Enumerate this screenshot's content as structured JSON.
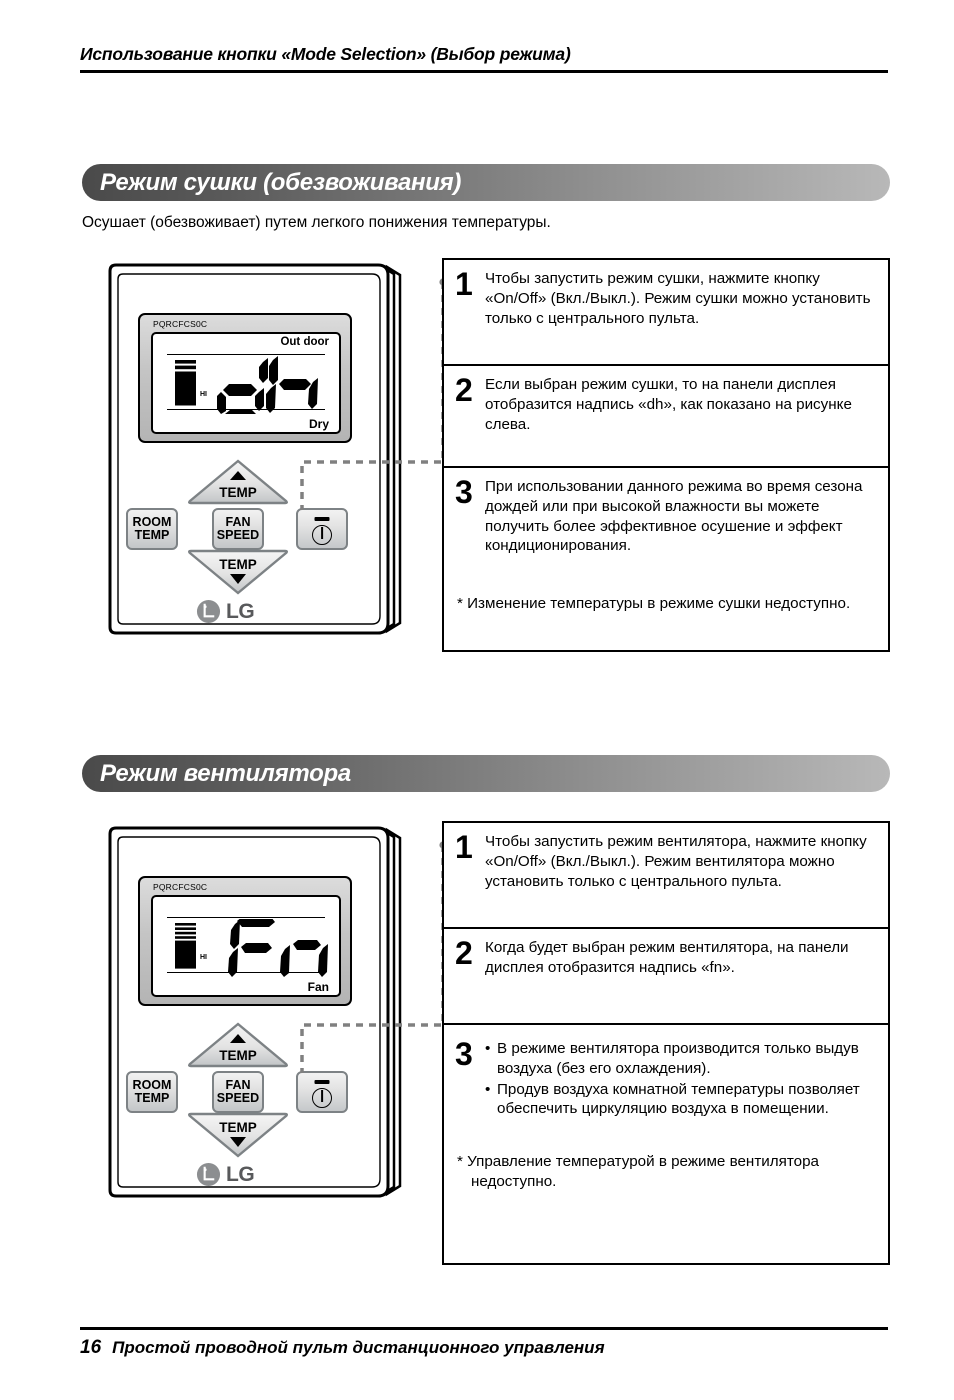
{
  "header": {
    "title": "Использование кнопки «Mode Selection» (Выбор режима)"
  },
  "sections": [
    {
      "id": "dry",
      "bar_title": "Режим сушки (обезвоживания)",
      "description": "Осушает (обезвоживает) путем легкого понижения температуры.",
      "remote": {
        "model_label": "PQRCFCS0C",
        "lcd_top_label": "Out door",
        "lcd_segment_text": "dh",
        "lcd_signal_label": "HI",
        "lcd_mode_label": "Dry",
        "buttons": {
          "temp_up": "TEMP",
          "temp_down": "TEMP",
          "room_temp_line1": "ROOM",
          "room_temp_line2": "TEMP",
          "fan_speed_line1": "FAN",
          "fan_speed_line2": "SPEED",
          "power": "On/Off",
          "brand": "LG"
        }
      },
      "steps": [
        {
          "num": "1",
          "text": "Чтобы запустить режим сушки, нажмите кнопку «On/Off» (Вкл./Выкл.). Режим сушки можно установить только с центрального пульта."
        },
        {
          "num": "2",
          "text": "Если выбран режим сушки, то на панели дисплея отобразится надпись «dh», как показано на рисунке слева."
        },
        {
          "num": "3",
          "text": "При использовании данного режима во время сезона дождей или при высокой влажности вы можете получить более эффективное осушение и эффект кондиционирования."
        }
      ],
      "note": "* Изменение температуры в режиме сушки недоступно."
    },
    {
      "id": "fan",
      "bar_title": "Режим вентилятора",
      "description": "",
      "remote": {
        "model_label": "PQRCFCS0C",
        "lcd_top_label": "",
        "lcd_segment_text": "Fn",
        "lcd_signal_label": "HI",
        "lcd_mode_label": "Fan",
        "buttons": {
          "temp_up": "TEMP",
          "temp_down": "TEMP",
          "room_temp_line1": "ROOM",
          "room_temp_line2": "TEMP",
          "fan_speed_line1": "FAN",
          "fan_speed_line2": "SPEED",
          "power": "On/Off",
          "brand": "LG"
        }
      },
      "steps": [
        {
          "num": "1",
          "text": "Чтобы запустить режим вентилятора, нажмите кнопку «On/Off» (Вкл./Выкл.). Режим вентилятора можно установить только с центрального пульта."
        },
        {
          "num": "2",
          "text": "Когда будет выбран режим вентилятора, на панели дисплея отобразится надпись «fn»."
        },
        {
          "num": "3",
          "bullets": [
            "В режиме вентилятора производится только выдув воздуха (без его охлаждения).",
            "Продув воздуха комнатной температуры позволяет обеспечить циркуляцию воздуха в помещении."
          ]
        }
      ],
      "note": "* Управление температурой в режиме вентилятора недоступно."
    }
  ],
  "footer": {
    "page_number": "16",
    "text": "Простой проводной пульт дистанционного управления"
  },
  "colors": {
    "bar_dark": "#4a4a4a",
    "bar_light": "#b8b8b8",
    "ink": "#000000",
    "button_border": "#7d8285",
    "lg_gray": "#58595b"
  }
}
